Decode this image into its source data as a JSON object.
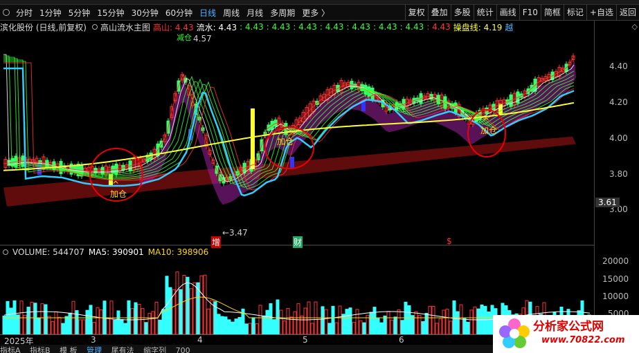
{
  "toolbar": {
    "periods": [
      "分时",
      "1分钟",
      "5分钟",
      "15分钟",
      "30分钟",
      "60分钟",
      "日线",
      "周线",
      "月线",
      "多周期",
      "更多 〉"
    ],
    "active_period": "日线",
    "right_buttons": [
      "复权",
      "叠加",
      "多股",
      "统计",
      "画线",
      "F10",
      "简框",
      "标记",
      "+自选",
      "返回"
    ]
  },
  "info": {
    "stock": "滨化股份 (日线,前复权)",
    "indicator": "高山流水主图",
    "gaoshan": "高山: 4.43",
    "liushui": "流水: 4.43",
    "repeat_value": ": 4.43",
    "caopan": "操盘线: 4.19",
    "more": "越"
  },
  "chart_labels": {
    "high": "4.57",
    "high_tag": "减仓",
    "low": "←3.47",
    "marker_zeng": "增",
    "marker_cai": "财",
    "marker_s": "$",
    "jiacang": "加仓",
    "caret": "^",
    "current_price": "3.61"
  },
  "y_axis": {
    "price_ticks": [
      "4.40",
      "4.20",
      "4.00",
      "3.80",
      "3.00"
    ],
    "volume_ticks": [
      "20000",
      "15000",
      "10000",
      "5000"
    ]
  },
  "volume_info": {
    "volume": "VOLUME: 544707",
    "ma5": "MA5: 390901",
    "ma10": "MA10: 398906"
  },
  "x_axis": {
    "labels": [
      "2025年",
      "3",
      "4",
      "5",
      "6"
    ]
  },
  "tabs": [
    "指标A",
    "指标B",
    "模 板",
    "管理",
    "尾有法",
    "缩字列",
    "700"
  ],
  "watermark": {
    "line1": "分析家公式网",
    "line2": "www.70822.com"
  },
  "colors": {
    "up": "#ff3333",
    "down": "#33ffff",
    "yellow": "#ffff33",
    "ma10": "#ffd700",
    "active": "#4fb2ff"
  }
}
